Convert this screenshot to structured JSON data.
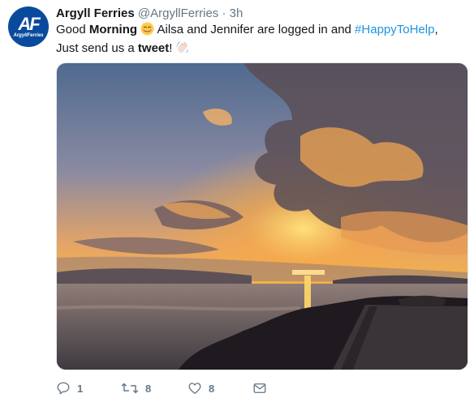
{
  "tweet": {
    "author_name": "Argyll Ferries",
    "handle": "@ArgyllFerries",
    "separator": "·",
    "time": "3h",
    "avatar_text": "AF",
    "avatar_subtext": "ArgyllFerries",
    "text": {
      "part1": "Good ",
      "bold1": "Morning",
      "part2": " Ailsa and Jennifer are logged in and ",
      "hashtag": "#HappyToHelp",
      "part3": ", Just send us a ",
      "bold2": "tweet",
      "part4": "!"
    },
    "icons": {
      "emoji1": "smiling-face-icon",
      "emoji2": "waving-hand-icon"
    },
    "photo": {
      "alt": "sunset-over-water-photo"
    }
  },
  "actions": {
    "reply_count": "1",
    "retweet_count": "8",
    "like_count": "8"
  },
  "colors": {
    "hashtag": "#1b95e0",
    "muted": "#657786",
    "avatar_bg": "#0a4a9e"
  }
}
